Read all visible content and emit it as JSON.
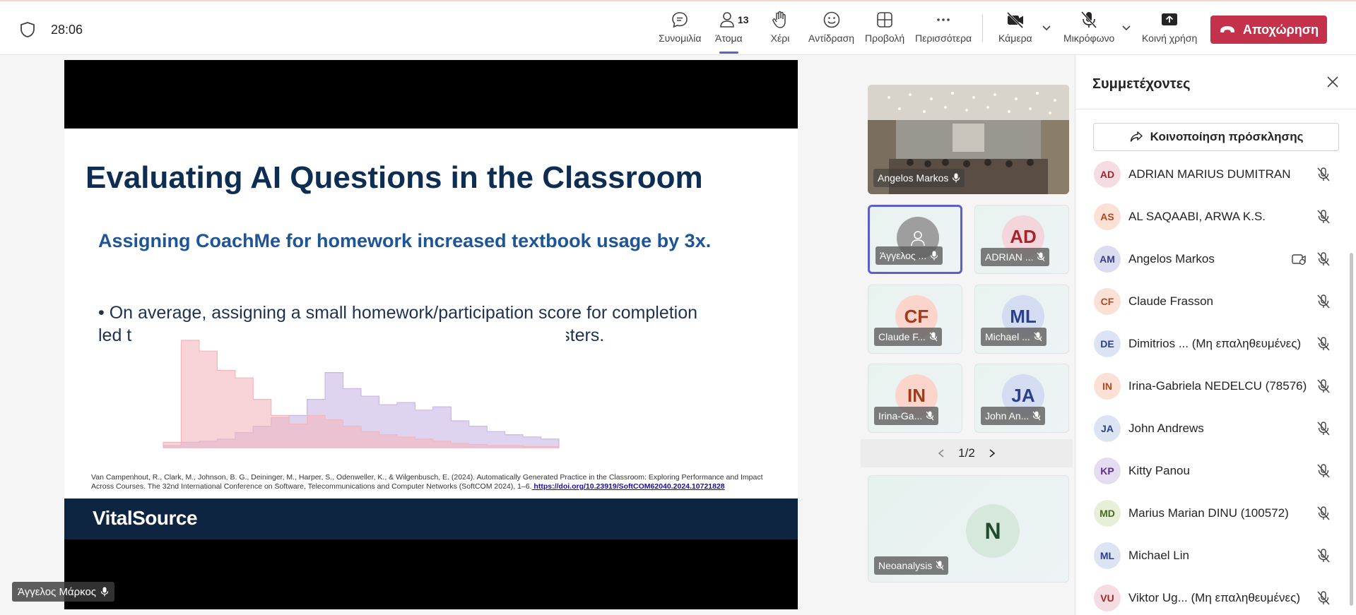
{
  "header": {
    "timer": "28:06",
    "toolbar": {
      "chat": "Συνομιλία",
      "people": "Άτομα",
      "people_count": "13",
      "hand": "Χέρι",
      "react": "Αντίδραση",
      "view": "Προβολή",
      "more": "Περισσότερα",
      "camera": "Κάμερα",
      "mic": "Μικρόφωνο",
      "share": "Κοινή χρήση",
      "leave": "Αποχώρηση"
    }
  },
  "slide": {
    "title": "Evaluating AI Questions in the Classroom",
    "subtitle": "Assigning CoachMe for homework increased textbook usage by 3x.",
    "bullet_line1": "• On average, assigning a small homework/participation score for completion",
    "bullet_line2_start": "led t",
    "bullet_line2_end": "ior semesters.",
    "citation": "Van Campenhout, R., Clark, M., Johnson, B. G., Deininger, M., Harper, S., Odenweller, K., & Wilgenbusch, E. (2024). Automatically Generated Practice in the Classroom: Exploring Performance and Impact Across Courses. The 32nd International Conference on Software, Telecommunications and Computer Networks (SoftCOM 2024), 1–6.",
    "citation_link": " https://doi.org/10.23919/SoftCOM62040.2024.10721828",
    "brand": "VitalSource",
    "presenter": "Άγγελος Μάρκος"
  },
  "chart_data": {
    "type": "area",
    "series": [
      {
        "color": "#f4b6bd",
        "values": [
          5,
          100,
          90,
          72,
          65,
          45,
          30,
          22,
          30,
          26,
          20,
          15,
          12,
          10,
          8,
          6,
          4,
          3,
          2,
          2,
          1,
          1
        ]
      },
      {
        "color": "#c9b8e6",
        "values": [
          2,
          5,
          6,
          8,
          14,
          20,
          28,
          30,
          45,
          70,
          55,
          48,
          40,
          42,
          35,
          38,
          25,
          20,
          15,
          12,
          10,
          8
        ]
      }
    ]
  },
  "grid": {
    "room_label": "Angelos Markos",
    "tiles": [
      {
        "initials": "",
        "label": "Άγγελος ...",
        "bg": "#9e9e9e",
        "fg": "#ffffff",
        "self": true
      },
      {
        "initials": "AD",
        "label": "ADRIAN ...",
        "bg": "#f5d5dc",
        "fg": "#a4262c",
        "self": false
      },
      {
        "initials": "CF",
        "label": "Claude F...",
        "bg": "#fbd5cc",
        "fg": "#a33a1a",
        "self": false
      },
      {
        "initials": "ML",
        "label": "Michael ...",
        "bg": "#d3dcf1",
        "fg": "#2b3f8c",
        "self": false
      },
      {
        "initials": "IN",
        "label": "Irina-Ga...",
        "bg": "#fbd5cc",
        "fg": "#a33a1a",
        "self": false
      },
      {
        "initials": "JA",
        "label": "John An...",
        "bg": "#d3dcf1",
        "fg": "#2b3f8c",
        "self": false
      }
    ],
    "pager": "1/2",
    "big_tile": {
      "initials": "N",
      "label": "Neoanalysis"
    }
  },
  "panel": {
    "title": "Συμμετέχοντες",
    "invite": "Κοινοποίηση πρόσκλησης",
    "participants": [
      {
        "initials": "AD",
        "name": "ADRIAN MARIUS DUMITRAN",
        "bg": "#f5dce2",
        "fg": "#a4262c",
        "cam": false
      },
      {
        "initials": "AS",
        "name": "AL SAQAABI, ARWA K.S.",
        "bg": "#fbe0d6",
        "fg": "#b4481e",
        "cam": false
      },
      {
        "initials": "AM",
        "name": "Angelos Markos",
        "bg": "#dcdcf1",
        "fg": "#3b3b8c",
        "cam": true
      },
      {
        "initials": "CF",
        "name": "Claude Frasson",
        "bg": "#fbe0d6",
        "fg": "#b4481e",
        "cam": false
      },
      {
        "initials": "DE",
        "name": "Dimitrios ... (Μη επαληθευμένες)",
        "bg": "#dce3f3",
        "fg": "#2b3f8c",
        "cam": false
      },
      {
        "initials": "IN",
        "name": "Irina-Gabriela NEDELCU (78576)",
        "bg": "#fbe0d6",
        "fg": "#b4481e",
        "cam": false
      },
      {
        "initials": "JA",
        "name": "John Andrews",
        "bg": "#dce3f3",
        "fg": "#2b3f8c",
        "cam": false
      },
      {
        "initials": "KP",
        "name": "Kitty Panou",
        "bg": "#e6dcf1",
        "fg": "#5c2e91",
        "cam": false
      },
      {
        "initials": "MD",
        "name": "Marius Marian DINU (100572)",
        "bg": "#e7efd8",
        "fg": "#4a6b1e",
        "cam": false
      },
      {
        "initials": "ML",
        "name": "Michael Lin",
        "bg": "#dce3f3",
        "fg": "#2b3f8c",
        "cam": false
      },
      {
        "initials": "VU",
        "name": "Viktor Ug... (Μη επαληθευμένες)",
        "bg": "#f5dce2",
        "fg": "#a4262c",
        "cam": false
      }
    ]
  }
}
